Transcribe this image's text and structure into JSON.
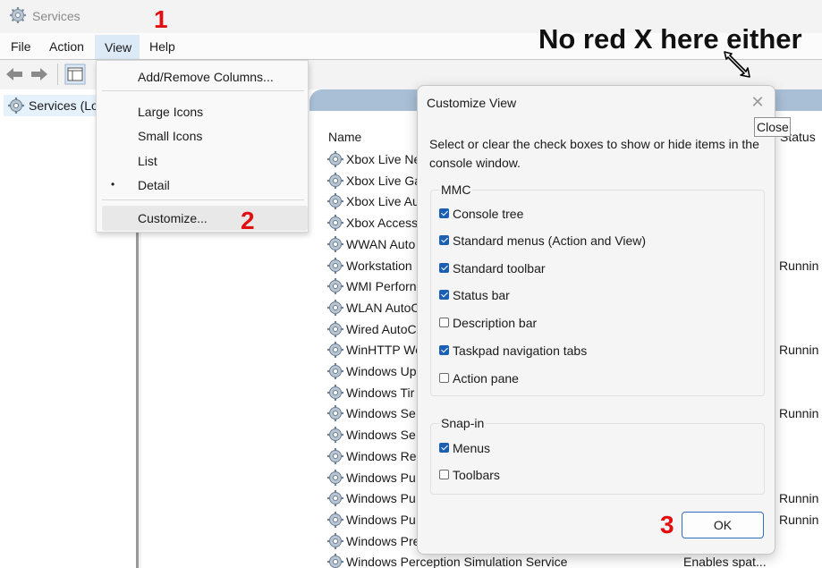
{
  "window": {
    "title": "Services"
  },
  "menubar": {
    "file": "File",
    "action": "Action",
    "view": "View",
    "help": "Help"
  },
  "tree": {
    "root_label": "Services (Lo"
  },
  "list": {
    "col_name": "Name",
    "col_status": "Status",
    "rows": [
      {
        "name": "Xbox Live Ne",
        "status": "",
        "desc": ""
      },
      {
        "name": "Xbox Live Ga",
        "status": "",
        "desc": ""
      },
      {
        "name": "Xbox Live Au",
        "status": "",
        "desc": ""
      },
      {
        "name": "Xbox Access",
        "status": "",
        "desc": ""
      },
      {
        "name": "WWAN Auto",
        "status": "",
        "desc": ""
      },
      {
        "name": "Workstation",
        "status": "Runnin",
        "desc": ""
      },
      {
        "name": "WMI Perforn",
        "status": "",
        "desc": ""
      },
      {
        "name": "WLAN AutoC",
        "status": "",
        "desc": ""
      },
      {
        "name": "Wired AutoC",
        "status": "",
        "desc": ""
      },
      {
        "name": "WinHTTP We",
        "status": "Runnin",
        "desc": ""
      },
      {
        "name": "Windows Up",
        "status": "",
        "desc": ""
      },
      {
        "name": "Windows Tir",
        "status": "",
        "desc": ""
      },
      {
        "name": "Windows Se",
        "status": "Runnin",
        "desc": ""
      },
      {
        "name": "Windows Se",
        "status": "",
        "desc": ""
      },
      {
        "name": "Windows Re",
        "status": "",
        "desc": ""
      },
      {
        "name": "Windows Pu",
        "status": "",
        "desc": ""
      },
      {
        "name": "Windows Pu",
        "status": "Runnin",
        "desc": ""
      },
      {
        "name": "Windows Pu",
        "status": "Runnin",
        "desc": ""
      },
      {
        "name": "Windows Pre",
        "status": "",
        "desc": ""
      },
      {
        "name": "Windows Perception Simulation Service",
        "status": "",
        "desc": "Enables spat..."
      }
    ]
  },
  "view_menu": {
    "add_remove_columns": "Add/Remove Columns...",
    "large_icons": "Large Icons",
    "small_icons": "Small Icons",
    "list": "List",
    "detail": "Detail",
    "detail_bullet": "•",
    "customize": "Customize..."
  },
  "dialog": {
    "title": "Customize View",
    "close_glyph": "✕",
    "description": "Select or clear the check boxes to show or hide items in the console window.",
    "mmc_group": {
      "label": "MMC",
      "items": [
        {
          "label": "Console tree",
          "checked": true
        },
        {
          "label": "Standard menus (Action and View)",
          "checked": true
        },
        {
          "label": "Standard toolbar",
          "checked": true
        },
        {
          "label": "Status bar",
          "checked": true
        },
        {
          "label": "Description bar",
          "checked": false
        },
        {
          "label": "Taskpad navigation tabs",
          "checked": true
        },
        {
          "label": "Action pane",
          "checked": false
        }
      ]
    },
    "snapin_group": {
      "label": "Snap-in",
      "items": [
        {
          "label": "Menus",
          "checked": true
        },
        {
          "label": "Toolbars",
          "checked": false
        }
      ]
    },
    "ok_label": "OK"
  },
  "tooltip": {
    "text": "Close"
  },
  "annotations": {
    "step1": "1",
    "step2": "2",
    "step3": "3",
    "caption": "No red X here either",
    "color": "#e10f0f"
  }
}
